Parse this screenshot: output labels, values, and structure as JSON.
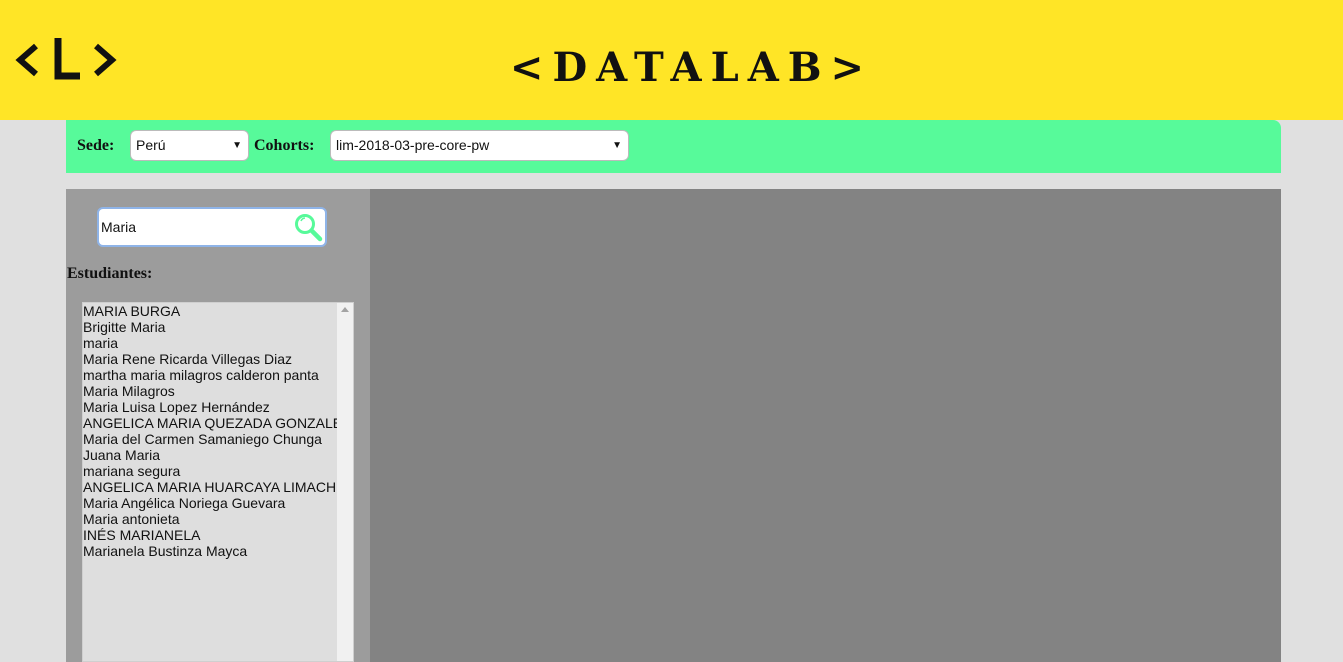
{
  "header": {
    "logo_text": "<L>",
    "brand": "<DATALAB>"
  },
  "filters": {
    "sede_label": "Sede:",
    "sede_value": "Perú",
    "cohorts_label": "Cohorts:",
    "cohorts_value": "lim-2018-03-pre-core-pw"
  },
  "sidebar": {
    "search_value": "Maria",
    "search_icon": "magnifier-icon",
    "list_title": "Estudiantes:",
    "students": [
      "MARIA BURGA",
      "Brigitte Maria",
      "maria",
      "Maria Rene Ricarda Villegas Diaz",
      "martha maria milagros calderon panta",
      "Maria Milagros",
      "Maria Luisa Lopez Hernández",
      "ANGELICA MARIA QUEZADA GONZALES",
      "Maria del Carmen Samaniego Chunga",
      "Juana Maria",
      "mariana segura",
      "ANGELICA MARIA HUARCAYA LIMACHI",
      "Maria Angélica Noriega Guevara",
      "Maria antonieta",
      "INÉS MARIANELA",
      "Marianela Bustinza Mayca"
    ]
  },
  "colors": {
    "header_bg": "#ffe526",
    "filter_bar_bg": "#57fa9a",
    "sidebar_bg": "#9c9c9c",
    "main_bg": "#838383",
    "search_icon_color": "#57fa9a"
  }
}
